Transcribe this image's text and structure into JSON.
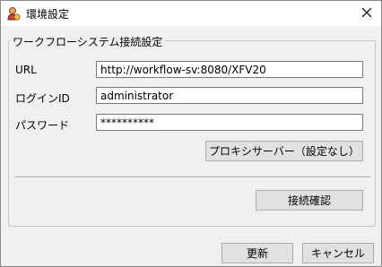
{
  "window": {
    "title": "環境設定",
    "icon": "settings-app-icon",
    "close_glyph": "✕"
  },
  "group": {
    "legend": "ワークフローシステム接続設定"
  },
  "fields": {
    "url": {
      "label": "URL",
      "value": "http://workflow-sv:8080/XFV20"
    },
    "login_id": {
      "label": "ログインID",
      "value": "administrator"
    },
    "password": {
      "label": "パスワード",
      "value": "**********"
    }
  },
  "buttons": {
    "proxy": "プロキシサーバー（設定なし）",
    "test_connection": "接続確認",
    "update": "更新",
    "cancel": "キャンセル"
  },
  "colors": {
    "window_bg": "#f0f0f0",
    "button_bg": "#e1e1e1",
    "button_border": "#adadad",
    "textbox_border": "#7a7a7a"
  }
}
